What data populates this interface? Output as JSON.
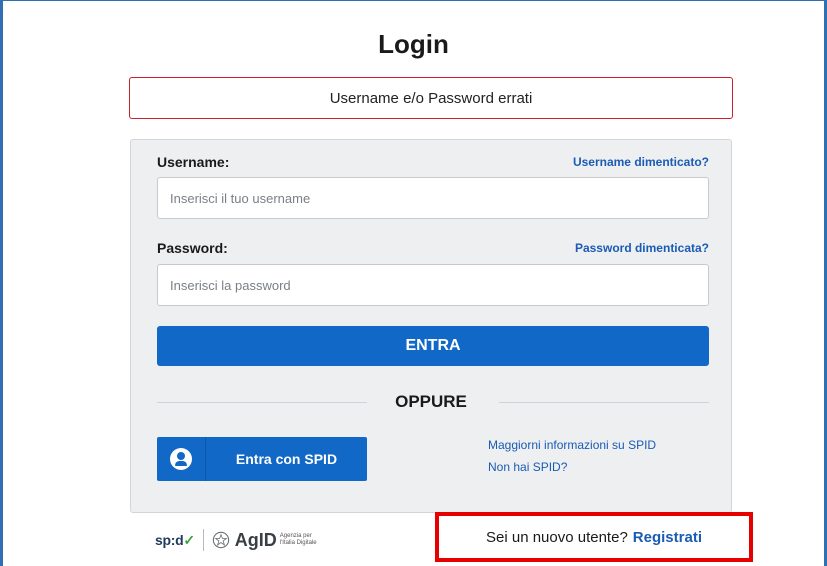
{
  "page": {
    "title": "Login",
    "error_message": "Username e/o Password errati"
  },
  "form": {
    "username_label": "Username:",
    "username_forgot": "Username dimenticato?",
    "username_placeholder": "Inserisci il tuo username",
    "username_value": "",
    "password_label": "Password:",
    "password_forgot": "Password dimenticata?",
    "password_placeholder": "Inserisci la password",
    "password_value": "",
    "submit_label": "ENTRA",
    "divider_label": "OPPURE"
  },
  "spid": {
    "button_label": "Entra con SPID",
    "icon": "user-circle-icon",
    "info_link": "Maggiorni informazioni su SPID",
    "no_spid_link": "Non hai SPID?"
  },
  "footer": {
    "spid_logo_text": "sp:d",
    "agid_logo_text": "AgID",
    "agid_subtext": "Agenzia per l'Italia Digitale",
    "register_prompt": "Sei un nuovo utente?",
    "register_link": "Registrati"
  },
  "colors": {
    "primary": "#1268c6",
    "link": "#1a5bb5",
    "error_border": "#c8202d",
    "highlight_border": "#e60000",
    "frame_border": "#2f6fb2"
  }
}
